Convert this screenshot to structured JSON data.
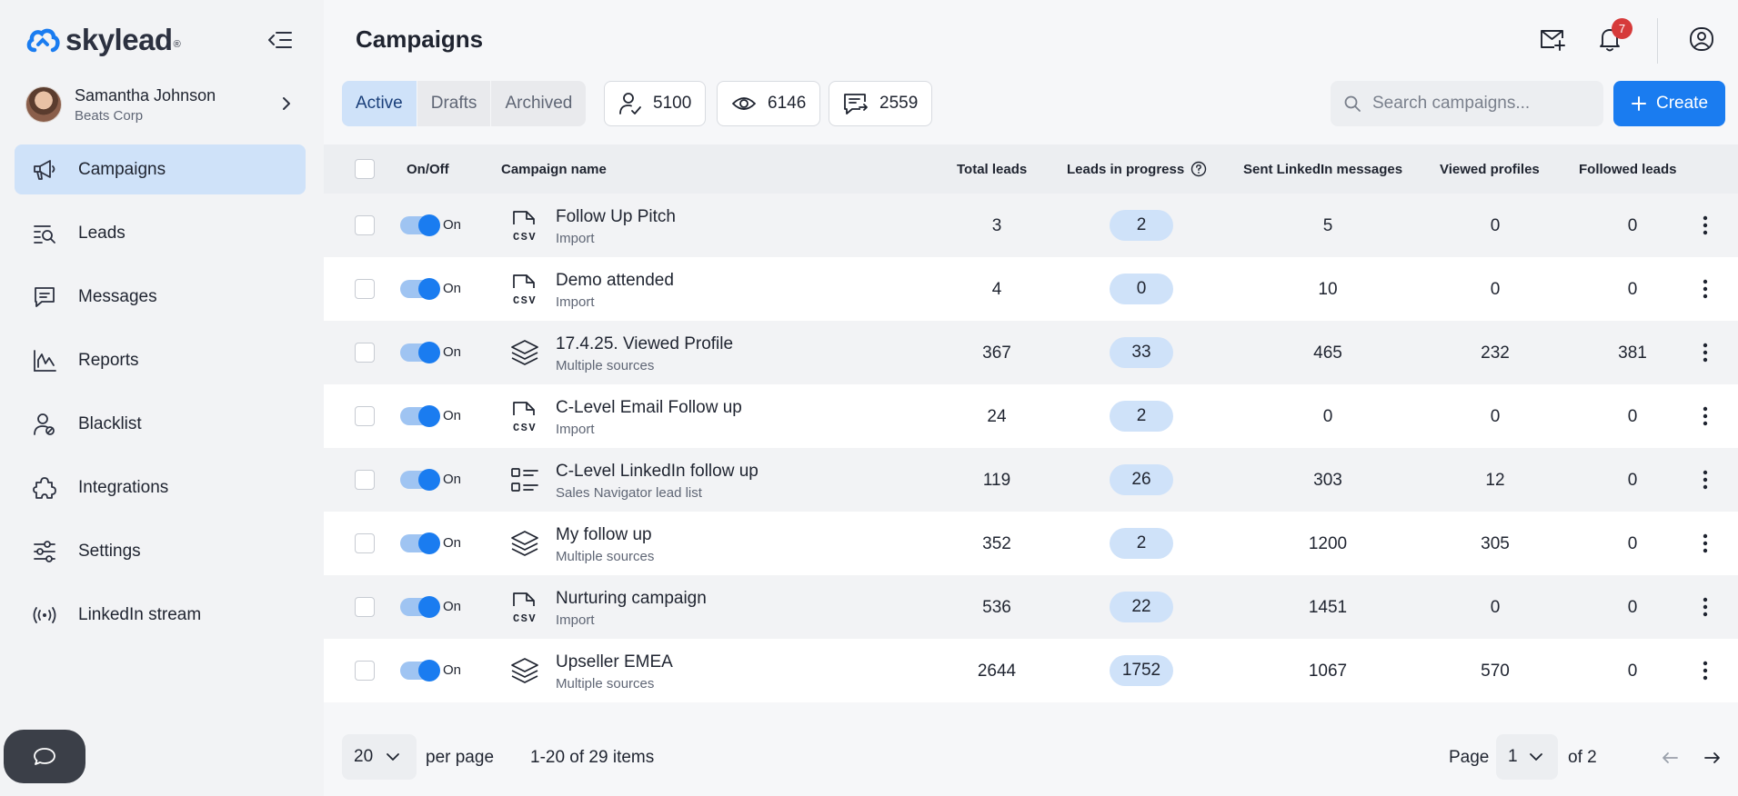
{
  "brand": {
    "name": "skylead",
    "registered": "®"
  },
  "user": {
    "name": "Samantha Johnson",
    "company": "Beats Corp"
  },
  "sidebar": {
    "items": [
      {
        "label": "Campaigns",
        "icon": "megaphone-icon",
        "active": true
      },
      {
        "label": "Leads",
        "icon": "leads-search-icon"
      },
      {
        "label": "Messages",
        "icon": "message-icon"
      },
      {
        "label": "Reports",
        "icon": "chart-icon"
      },
      {
        "label": "Blacklist",
        "icon": "user-block-icon"
      },
      {
        "label": "Integrations",
        "icon": "puzzle-icon"
      },
      {
        "label": "Settings",
        "icon": "sliders-icon"
      },
      {
        "label": "LinkedIn stream",
        "icon": "broadcast-icon"
      }
    ]
  },
  "header": {
    "title": "Campaigns",
    "notifications_count": "7"
  },
  "tabs": [
    "Active",
    "Drafts",
    "Archived"
  ],
  "stats": {
    "leads": "5100",
    "views": "6146",
    "messages": "2559"
  },
  "search": {
    "placeholder": "Search campaigns..."
  },
  "create_label": "Create",
  "table": {
    "headers": {
      "onoff": "On/Off",
      "name": "Campaign name",
      "total": "Total leads",
      "progress": "Leads in progress",
      "sent": "Sent LinkedIn messages",
      "viewed": "Viewed profiles",
      "followed": "Followed leads"
    },
    "toggle_label": "On",
    "rows": [
      {
        "name": "Follow Up Pitch",
        "source": "Import",
        "icon": "csv-file-icon",
        "total": "3",
        "progress": "2",
        "sent": "5",
        "viewed": "0",
        "followed": "0"
      },
      {
        "name": "Demo attended",
        "source": "Import",
        "icon": "csv-file-icon",
        "total": "4",
        "progress": "0",
        "sent": "10",
        "viewed": "0",
        "followed": "0"
      },
      {
        "name": "17.4.25. Viewed Profile",
        "source": "Multiple sources",
        "icon": "layers-icon",
        "total": "367",
        "progress": "33",
        "sent": "465",
        "viewed": "232",
        "followed": "381"
      },
      {
        "name": "C-Level Email Follow up",
        "source": "Import",
        "icon": "csv-file-icon",
        "total": "24",
        "progress": "2",
        "sent": "0",
        "viewed": "0",
        "followed": "0"
      },
      {
        "name": "C-Level LinkedIn follow up",
        "source": "Sales Navigator lead list",
        "icon": "list-icon",
        "total": "119",
        "progress": "26",
        "sent": "303",
        "viewed": "12",
        "followed": "0"
      },
      {
        "name": "My follow up",
        "source": "Multiple sources",
        "icon": "layers-icon",
        "total": "352",
        "progress": "2",
        "sent": "1200",
        "viewed": "305",
        "followed": "0"
      },
      {
        "name": "Nurturing campaign",
        "source": "Import",
        "icon": "csv-file-icon",
        "total": "536",
        "progress": "22",
        "sent": "1451",
        "viewed": "0",
        "followed": "0"
      },
      {
        "name": "Upseller EMEA",
        "source": "Multiple sources",
        "icon": "layers-icon",
        "total": "2644",
        "progress": "1752",
        "sent": "1067",
        "viewed": "570",
        "followed": "0"
      }
    ]
  },
  "footer": {
    "per_page_value": "20",
    "per_page_label": "per page",
    "items_info": "1-20 of 29 items",
    "page_label": "Page",
    "page_value": "1",
    "page_of": "of 2"
  },
  "colors": {
    "accent": "#1a7cf0",
    "active_bg": "#cfe2f9",
    "badge": "#d63a3a"
  }
}
